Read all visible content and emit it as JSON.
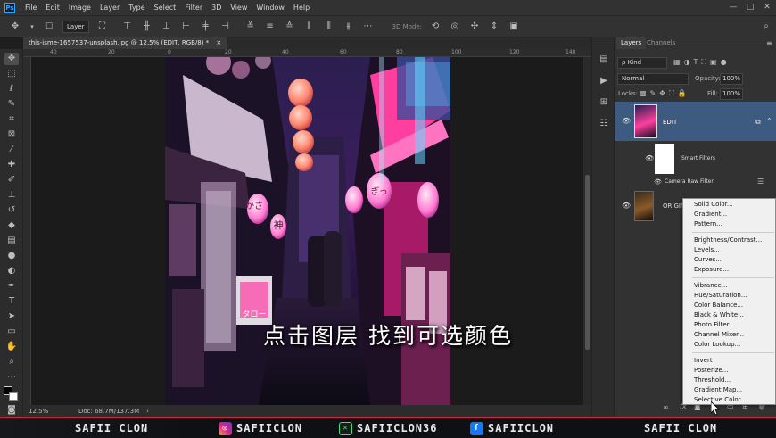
{
  "menubar": {
    "logo": "Ps",
    "items": [
      "File",
      "Edit",
      "Image",
      "Layer",
      "Type",
      "Select",
      "Filter",
      "3D",
      "View",
      "Window",
      "Help"
    ],
    "window_controls": [
      "—",
      "□",
      "✕"
    ]
  },
  "options_bar": {
    "auto_select_value": "Layer",
    "mode_3d_label": "3D Mode:"
  },
  "document": {
    "tab_title": "this-isme-1657537-unsplash.jpg @ 12.5% (EDIT, RGB/8) *",
    "close_glyph": "×"
  },
  "rulers": {
    "top_ticks": [
      "40",
      "20",
      "0",
      "20",
      "40",
      "60",
      "80",
      "100",
      "120",
      "140"
    ]
  },
  "status": {
    "zoom": "12.5%",
    "doc_size": "Doc: 68.7M/137.3M",
    "arrow": "›"
  },
  "layers_panel": {
    "tabs": [
      "Layers",
      "Channels"
    ],
    "kind_filter": "ρ Kind",
    "blend_mode": "Normal",
    "opacity_label": "Opacity:",
    "opacity_value": "100%",
    "lock_label": "Locks:",
    "fill_label": "Fill:",
    "fill_value": "100%",
    "layers": [
      {
        "name": "EDIT",
        "selected": true
      },
      {
        "name": "Smart Filters",
        "selected": false
      },
      {
        "name": "Camera Raw Filter",
        "selected": false
      },
      {
        "name": "ORIGIN",
        "selected": false
      }
    ],
    "bottom_icons": [
      "∞",
      "fx"
    ]
  },
  "adjustment_menu": {
    "groups": [
      [
        "Solid Color...",
        "Gradient...",
        "Pattern..."
      ],
      [
        "Brightness/Contrast...",
        "Levels...",
        "Curves...",
        "Exposure..."
      ],
      [
        "Vibrance...",
        "Hue/Saturation...",
        "Color Balance...",
        "Black & White...",
        "Photo Filter...",
        "Channel Mixer...",
        "Color Lookup..."
      ],
      [
        "Invert",
        "Posterize...",
        "Threshold...",
        "Gradient Map...",
        "Selective Color..."
      ]
    ]
  },
  "photo_signs": [
    "かさ",
    "神",
    "ぎっ",
    "タロー"
  ],
  "subtitle": "点击图层 找到可选颜色",
  "social_bar": {
    "left_name": "SAFII CLON",
    "instagram": "SAFIICLON",
    "twitter": "SAFIICLON36",
    "facebook": "SAFIICLON",
    "right_name": "SAFII CLON",
    "instagram_icon": "instagram-icon",
    "twitter_icon": "x-icon",
    "facebook_icon": "facebook-icon"
  },
  "colors": {
    "accent_red": "#d4223a",
    "panel_bg": "#323232",
    "selected_layer": "#3d5a80",
    "ps_blue": "#31a8ff"
  }
}
